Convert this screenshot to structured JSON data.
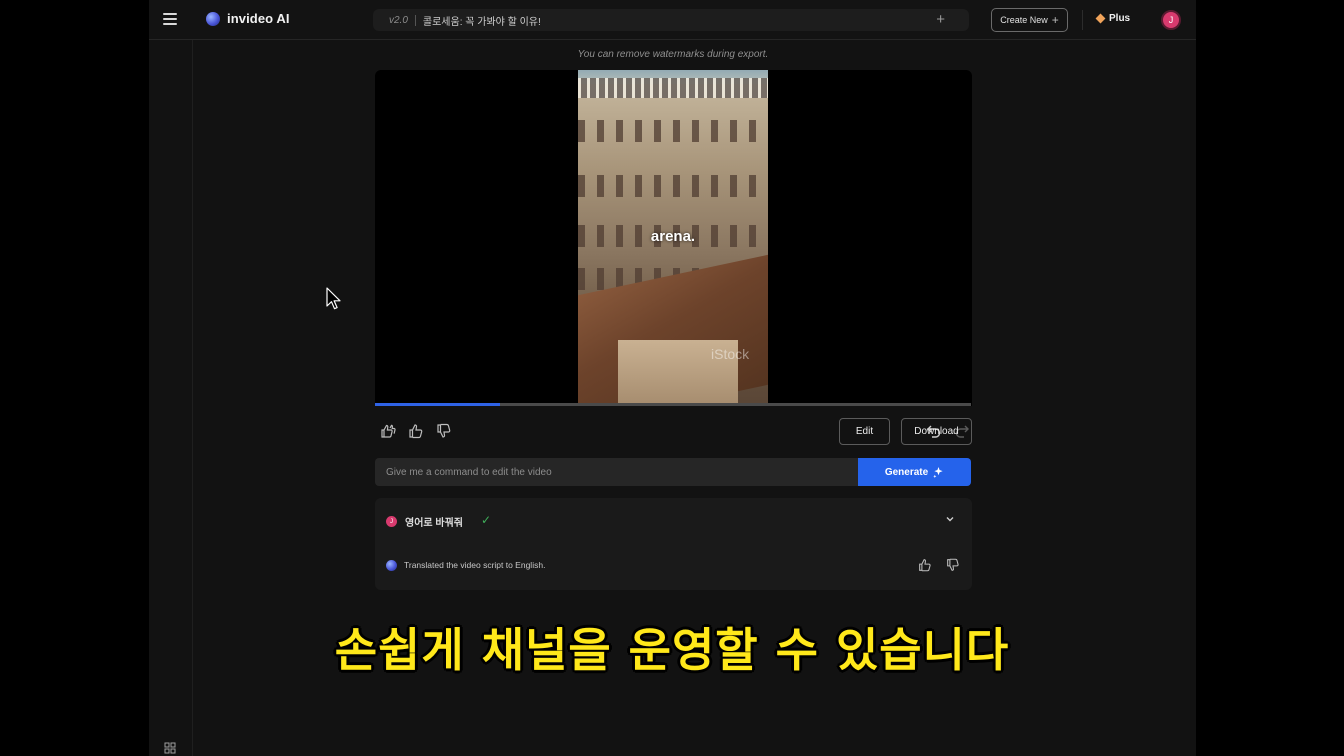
{
  "app": {
    "name": "invideo AI"
  },
  "header": {
    "version": "v2.0",
    "project_title": "콜로세움: 꼭 가봐야 할 이유!",
    "create_new_label": "Create New",
    "plan_label": "Plus",
    "avatar_initial": "J",
    "accent_color": "#2563eb"
  },
  "player": {
    "watermark_note": "You can remove watermarks during export.",
    "caption": "arena.",
    "stock_watermark": "iStock",
    "progress": 0.21
  },
  "actions": {
    "edit_label": "Edit",
    "download_label": "Download"
  },
  "command": {
    "placeholder": "Give me a command to edit the video",
    "generate_label": "Generate"
  },
  "history": {
    "user_initial": "J",
    "user_message": "영어로 바꿔줘",
    "ai_response": "Translated the video script to English."
  },
  "overlay": {
    "subtitle": "손쉽게 채널을 운영할 수 있습니다"
  }
}
